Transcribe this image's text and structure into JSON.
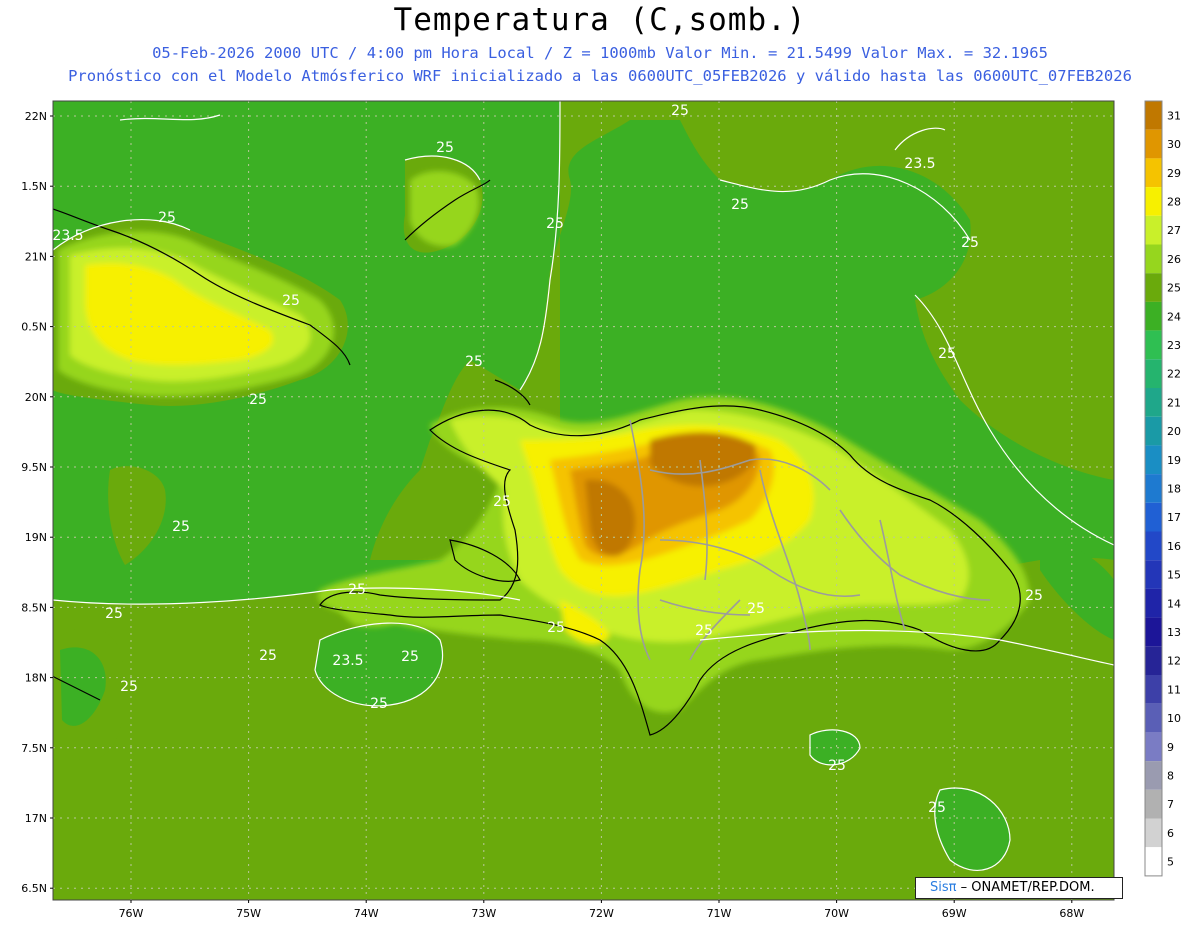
{
  "header": {
    "title": "Temperatura (C,somb.)",
    "line1": "05-Feb-2026  2000 UTC / 4:00 pm Hora Local / Z = 1000mb   Valor Min. = 21.5499  Valor Max. = 32.1965",
    "line2": "Pronóstico con el Modelo Atmósferico WRF inicializado a las 0600UTC_05FEB2026 y válido hasta las  0600UTC_07FEB2026"
  },
  "axes": {
    "lat_labels": [
      "22N",
      "1.5N",
      "21N",
      "0.5N",
      "20N",
      "9.5N",
      "19N",
      "8.5N",
      "18N",
      "7.5N",
      "17N",
      "6.5N"
    ],
    "lon_labels": [
      "76W",
      "75W",
      "74W",
      "73W",
      "72W",
      "71W",
      "70W",
      "69W",
      "68W"
    ]
  },
  "colorbar": {
    "labels": [
      "31",
      "30",
      "29",
      "28",
      "27",
      "26",
      "25",
      "24",
      "23",
      "22",
      "21",
      "20",
      "19",
      "18",
      "17",
      "16",
      "15",
      "14",
      "13",
      "12",
      "11",
      "10",
      "9",
      "8",
      "7",
      "6",
      "5"
    ],
    "colors": [
      "#c07800",
      "#e09600",
      "#f5c300",
      "#f7f000",
      "#c9f02a",
      "#96d61e",
      "#6aaa0c",
      "#3cb024",
      "#2fbf52",
      "#25b46e",
      "#1fa78a",
      "#1a9aa6",
      "#1a8ec4",
      "#1e7ad0",
      "#2060d4",
      "#2248c8",
      "#2336b8",
      "#1f24a8",
      "#1c1598",
      "#262496",
      "#3d40a8",
      "#5a5fb6",
      "#7a7cc4",
      "#9a9bb0",
      "#b1b1b1",
      "#d2d2d2",
      "#ffffff"
    ]
  },
  "contours": {
    "labels": [
      {
        "text": "25",
        "id": "c1"
      },
      {
        "text": "25",
        "id": "c2"
      },
      {
        "text": "23.5",
        "id": "c3"
      },
      {
        "text": "25",
        "id": "c4"
      },
      {
        "text": "23.5",
        "id": "c5"
      },
      {
        "text": "25",
        "id": "c6"
      },
      {
        "text": "25",
        "id": "c7"
      },
      {
        "text": "25",
        "id": "c8"
      },
      {
        "text": "25",
        "id": "c9"
      },
      {
        "text": "25",
        "id": "c10"
      },
      {
        "text": "25",
        "id": "c11"
      },
      {
        "text": "25",
        "id": "c12"
      },
      {
        "text": "25",
        "id": "c13"
      },
      {
        "text": "25",
        "id": "c14"
      },
      {
        "text": "25",
        "id": "c15"
      },
      {
        "text": "25",
        "id": "c16"
      },
      {
        "text": "25",
        "id": "c17"
      },
      {
        "text": "23.5",
        "id": "c18"
      },
      {
        "text": "25",
        "id": "c19"
      },
      {
        "text": "25",
        "id": "c20"
      },
      {
        "text": "25",
        "id": "c21"
      },
      {
        "text": "25",
        "id": "c22"
      },
      {
        "text": "25",
        "id": "c23"
      },
      {
        "text": "25",
        "id": "c24"
      },
      {
        "text": "25",
        "id": "c25"
      },
      {
        "text": "25",
        "id": "c26"
      },
      {
        "text": "25",
        "id": "c27"
      }
    ]
  },
  "logo": {
    "brand": "Sisπ",
    "text": " – ONAMET/REP.DOM."
  }
}
